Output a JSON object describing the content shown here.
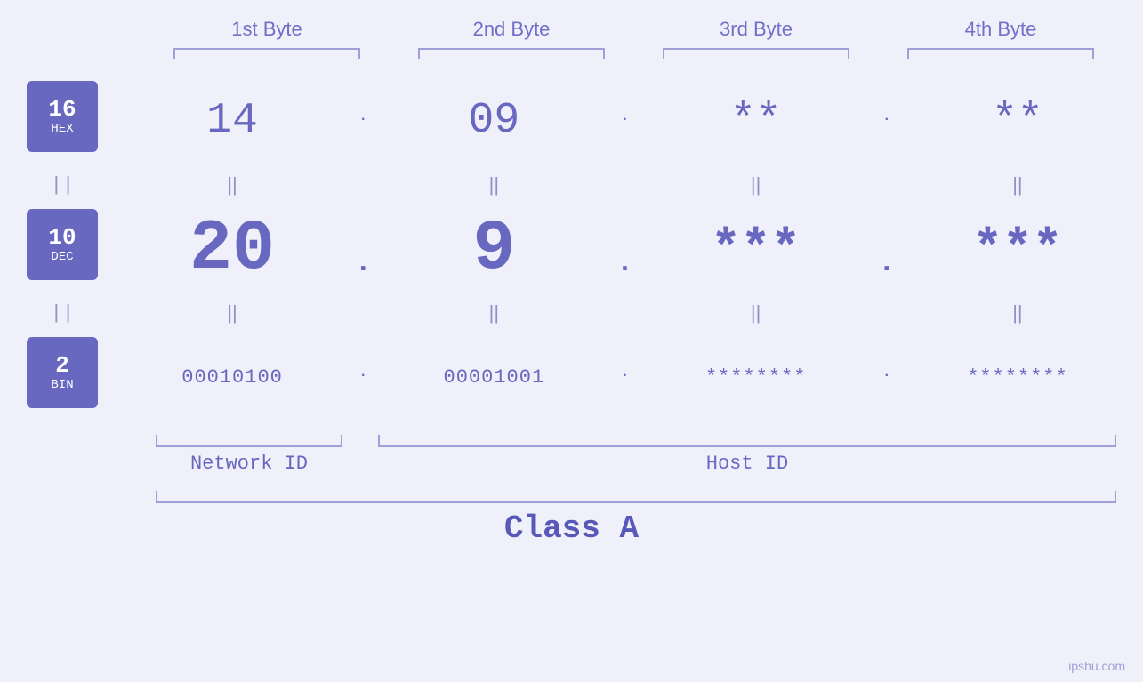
{
  "byteHeaders": [
    "1st Byte",
    "2nd Byte",
    "3rd Byte",
    "4th Byte"
  ],
  "bases": [
    {
      "number": "16",
      "label": "HEX"
    },
    {
      "number": "10",
      "label": "DEC"
    },
    {
      "number": "2",
      "label": "BIN"
    }
  ],
  "hexRow": {
    "values": [
      "14",
      "09",
      "**",
      "**"
    ],
    "dots": [
      ".",
      ".",
      "."
    ]
  },
  "decRow": {
    "values": [
      "20",
      "9",
      "***",
      "***"
    ],
    "dots": [
      ".",
      ".",
      "."
    ]
  },
  "binRow": {
    "values": [
      "00010100",
      "00001001",
      "********",
      "********"
    ],
    "dots": [
      ".",
      ".",
      "."
    ]
  },
  "networkIdLabel": "Network ID",
  "hostIdLabel": "Host ID",
  "classLabel": "Class A",
  "watermark": "ipshu.com"
}
